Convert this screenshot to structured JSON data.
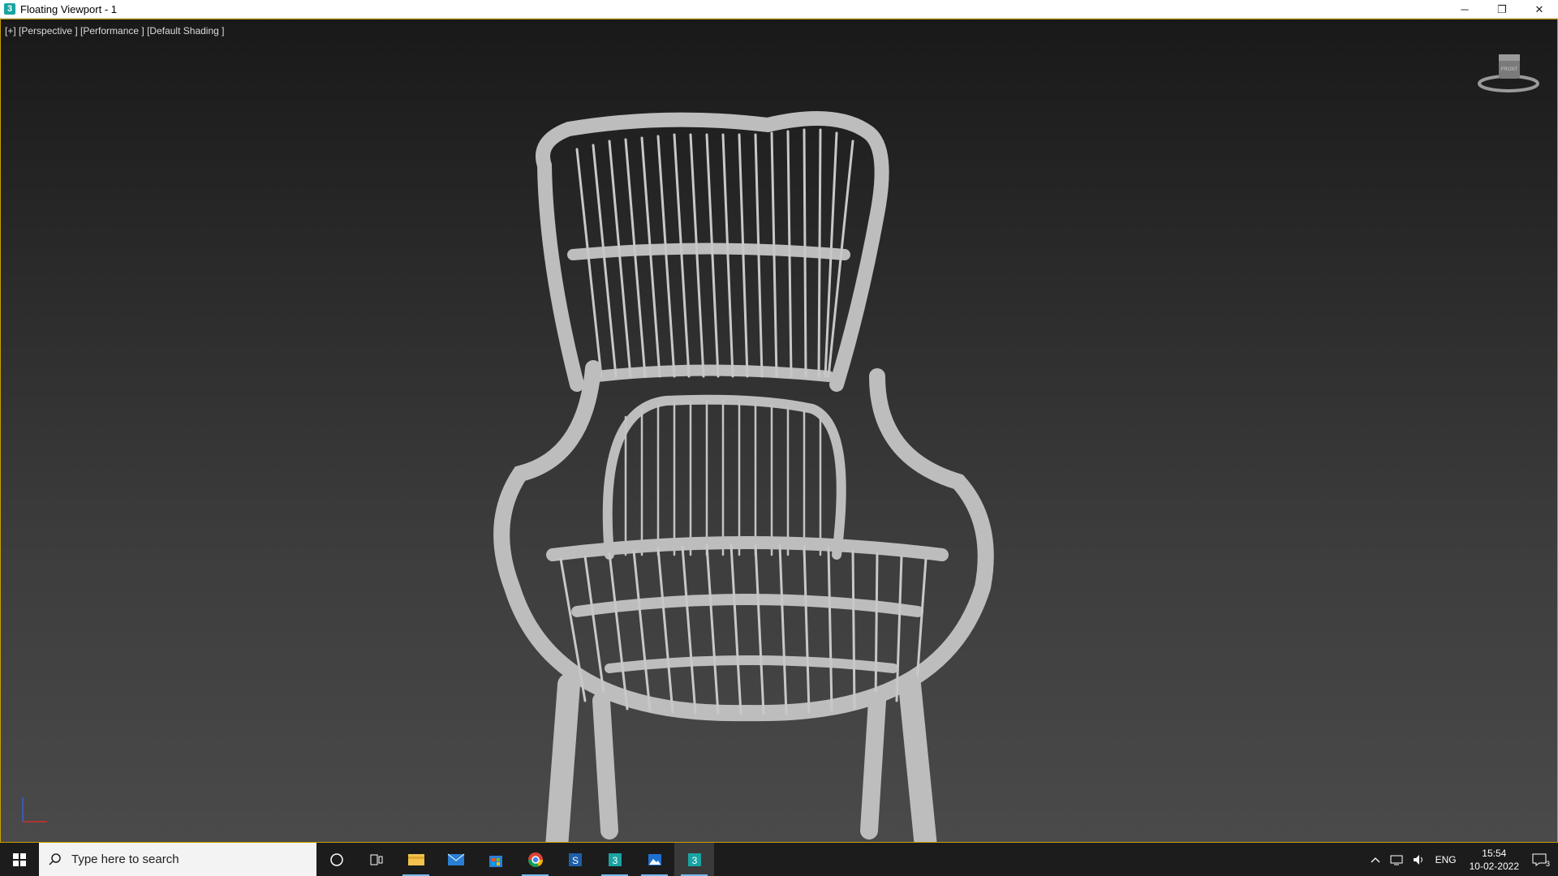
{
  "window": {
    "title": "Floating Viewport - 1",
    "app_icon": "3"
  },
  "window_controls": {
    "minimize": "─",
    "restore": "❐",
    "close": "✕"
  },
  "viewport": {
    "label": "[+] [Perspective ] [Performance ] [Default Shading ]",
    "viewcube_face": "FRONT",
    "border_color": "#c8a000"
  },
  "taskbar": {
    "search_placeholder": "Type here to search",
    "apps": [
      "cortana-icon",
      "task-view-icon",
      "file-explorer-icon",
      "mail-icon",
      "store-icon",
      "chrome-icon",
      "sketchup-icon",
      "3dsmax-icon",
      "photos-icon",
      "3dsmax-active-icon"
    ],
    "tray": {
      "language": "ENG",
      "time": "15:54",
      "date": "10-02-2022",
      "notifications": "3"
    }
  }
}
